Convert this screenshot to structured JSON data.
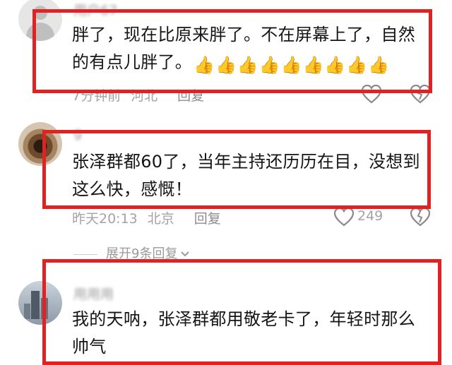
{
  "comments": [
    {
      "username": "用户67",
      "text_line1": "胖了，现在比原来胖了。不在屏幕上了，自然",
      "text_line2": "的有点儿胖了。",
      "emojis": "👍👍👍👍👍👍👍👍👍",
      "time": "7分钟前",
      "location": "河北",
      "reply_label": "回复"
    },
    {
      "username": "g",
      "text_line1": "张泽群都60了，当年主持还历历在目，没想到",
      "text_line2": "这么快，感慨！",
      "time": "昨天20:13",
      "location": "北京",
      "reply_label": "回复",
      "like_count": "249"
    },
    {
      "username": "用用用",
      "text_line1": "我的天呐，张泽群都用敬老卡了，年轻时那么",
      "text_line2": "帅气"
    }
  ],
  "expand_replies_label": "展开9条回复",
  "colors": {
    "highlight_border": "#e02222",
    "meta_gray": "#a3a3a3"
  }
}
